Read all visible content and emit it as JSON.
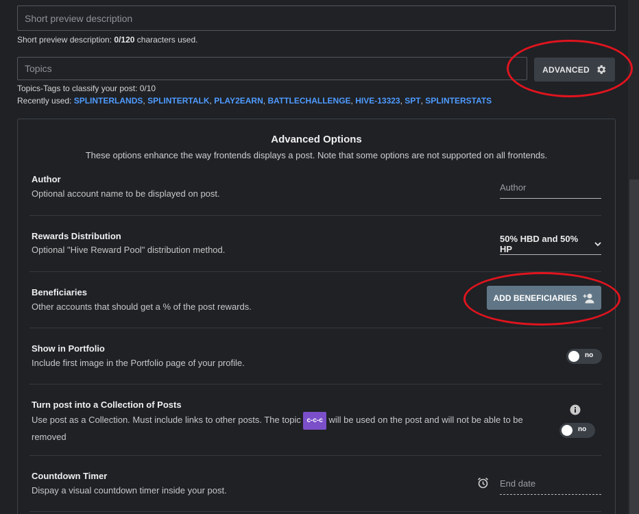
{
  "short_preview": {
    "placeholder": "Short preview description",
    "counter_label": "Short preview description: ",
    "counter_value": "0/120",
    "counter_suffix": " characters used."
  },
  "topics": {
    "placeholder": "Topics",
    "hint": "Topics-Tags to classify your post: 0/10",
    "recently_used_label": "Recently used: ",
    "recent_tags": [
      "SPLINTERLANDS",
      "SPLINTERTALK",
      "PLAY2EARN",
      "BATTLECHALLENGE",
      "HIVE-13323",
      "SPT",
      "SPLINTERSTATS"
    ]
  },
  "advanced_button": {
    "label": "ADVANCED",
    "icon": "gear-icon"
  },
  "advanced_options": {
    "title": "Advanced Options",
    "subtitle": "These options enhance the way frontends displays a post. Note that some options are not supported on all frontends.",
    "author": {
      "title": "Author",
      "desc": "Optional account name to be displayed on post.",
      "placeholder": "Author"
    },
    "rewards": {
      "title": "Rewards Distribution",
      "desc": "Optional \"Hive Reward Pool\" distribution method.",
      "selected": "50% HBD and 50% HP"
    },
    "beneficiaries": {
      "title": "Beneficiaries",
      "desc": "Other accounts that should get a % of the post rewards.",
      "button_label": "ADD BENEFICIARIES"
    },
    "portfolio": {
      "title": "Show in Portfolio",
      "desc": "Include first image in the Portfolio page of your profile.",
      "toggle_label": "no"
    },
    "collection": {
      "title": "Turn post into a Collection of Posts",
      "desc_before": "Use post as a Collection. Must include links to other posts. The topic ",
      "badge": "c-c-c",
      "desc_after": " will be used on the post and will not be able to be removed",
      "toggle_label": "no"
    },
    "countdown": {
      "title": "Countdown Timer",
      "desc": "Dispay a visual countdown timer inside your post.",
      "placeholder": "End date"
    }
  },
  "colors": {
    "background": "#1f2125",
    "link": "#4f9bff",
    "accent_button": "#607686",
    "highlight_oval": "#e0141e",
    "badge": "#7b4fc9"
  }
}
